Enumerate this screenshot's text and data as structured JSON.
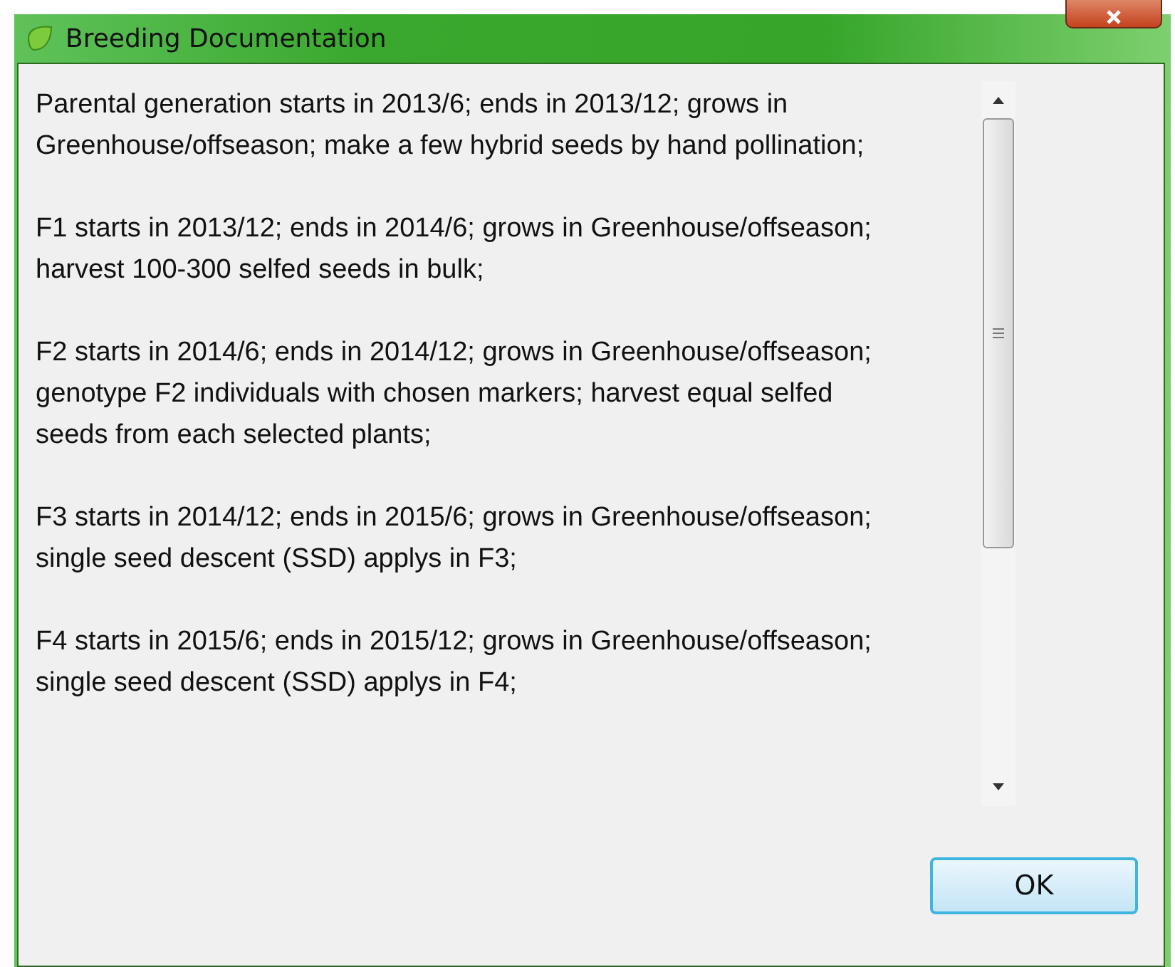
{
  "window": {
    "title": "Breeding Documentation"
  },
  "paragraphs": [
    "Parental generation starts in 2013/6; ends in 2013/12; grows in Greenhouse/offseason; make a few hybrid seeds by hand pollination;",
    "F1 starts in 2013/12; ends in 2014/6; grows in Greenhouse/offseason; harvest 100-300 selfed seeds in bulk;",
    "F2 starts in 2014/6; ends in 2014/12; grows in Greenhouse/offseason; genotype F2 individuals with chosen markers; harvest equal selfed seeds from each selected plants;",
    "F3 starts in 2014/12; ends in 2015/6; grows in Greenhouse/offseason; single seed descent (SSD) applys in F3;",
    "F4 starts in 2015/6; ends in 2015/12; grows in Greenhouse/offseason; single seed descent (SSD) applys in F4;"
  ],
  "buttons": [
    "OK"
  ]
}
